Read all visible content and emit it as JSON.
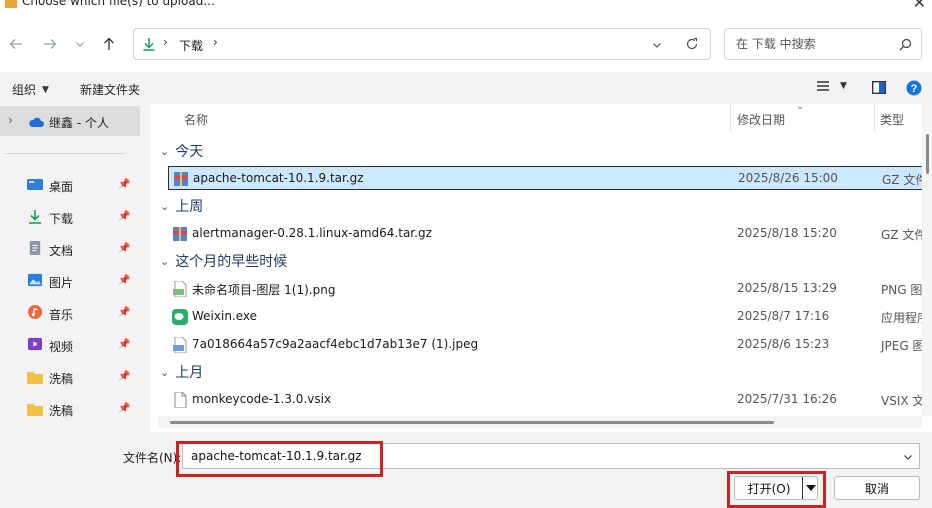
{
  "window": {
    "title": "Choose which file(s) to upload..."
  },
  "nav": {
    "back_icon": "arrow-left-icon",
    "forward_icon": "arrow-right-icon",
    "recent_icon": "chevron-down-icon",
    "up_icon": "arrow-up-icon",
    "address": {
      "crumb": "下载"
    },
    "search_placeholder": "在 下载 中搜索"
  },
  "toolbar": {
    "organize_label": "组织",
    "new_folder_label": "新建文件夹"
  },
  "sidebar": {
    "top_item": "继鑫 - 个人",
    "items": [
      {
        "label": "桌面",
        "icon": "desktop-icon"
      },
      {
        "label": "下载",
        "icon": "download-icon"
      },
      {
        "label": "文档",
        "icon": "document-icon"
      },
      {
        "label": "图片",
        "icon": "pictures-icon"
      },
      {
        "label": "音乐",
        "icon": "music-icon"
      },
      {
        "label": "视频",
        "icon": "video-icon"
      },
      {
        "label": "洗稿",
        "icon": "folder-icon"
      },
      {
        "label": "洗稿",
        "icon": "folder-icon"
      }
    ]
  },
  "columns": {
    "name": "名称",
    "date": "修改日期",
    "type": "类型"
  },
  "groups": [
    {
      "label": "今天",
      "files": [
        {
          "name": "apache-tomcat-10.1.9.tar.gz",
          "date": "2025/8/26 15:00",
          "type": "GZ 文件",
          "icon": "archive-icon",
          "selected": true
        }
      ]
    },
    {
      "label": "上周",
      "files": [
        {
          "name": "alertmanager-0.28.1.linux-amd64.tar.gz",
          "date": "2025/8/18 15:20",
          "type": "GZ 文件",
          "icon": "archive-icon"
        }
      ]
    },
    {
      "label": "这个月的早些时候",
      "files": [
        {
          "name": "未命名项目-图层 1(1).png",
          "date": "2025/8/15 13:29",
          "type": "PNG 图",
          "icon": "image-icon"
        },
        {
          "name": "Weixin.exe",
          "date": "2025/8/7 17:16",
          "type": "应用程序",
          "icon": "wechat-icon"
        },
        {
          "name": "7a018664a57c9a2aacf4ebc1d7ab13e7 (1).jpeg",
          "date": "2025/8/6 15:23",
          "type": "JPEG 图",
          "icon": "image-icon"
        }
      ]
    },
    {
      "label": "上月",
      "files": [
        {
          "name": "monkeycode-1.3.0.vsix",
          "date": "2025/7/31 16:26",
          "type": "VSIX 文",
          "icon": "file-icon"
        }
      ]
    }
  ],
  "bottom": {
    "filename_label": "文件名(N):",
    "filename_value": "apache-tomcat-10.1.9.tar.gz",
    "open_label": "打开(O)",
    "cancel_label": "取消"
  },
  "colors": {
    "accent": "#0078d4",
    "selection": "#cce8ff",
    "highlight_red": "#d02020"
  }
}
